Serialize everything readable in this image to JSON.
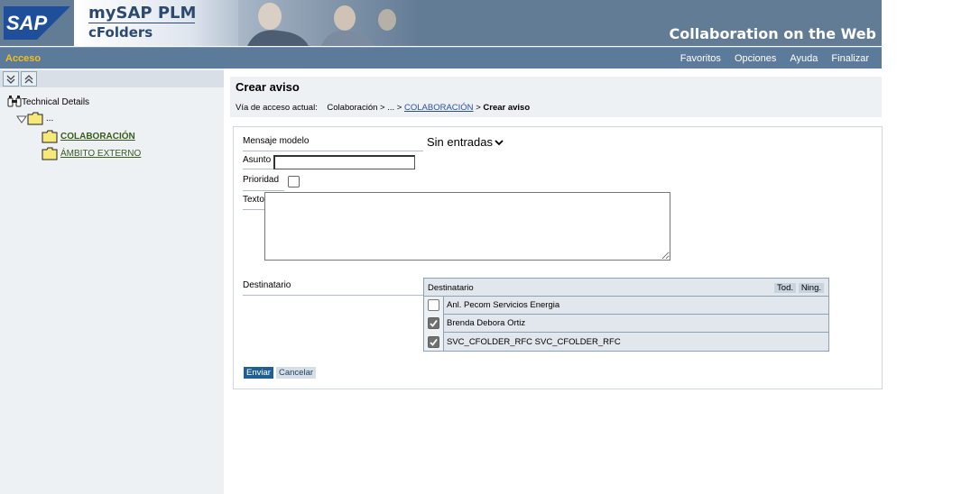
{
  "header": {
    "logo_text": "SAP",
    "brand_line1": "mySAP PLM",
    "brand_line2": "cFolders",
    "tagline": "Collaboration on the Web"
  },
  "navbar": {
    "section": "Acceso",
    "links": [
      "Favoritos",
      "Opciones",
      "Ayuda",
      "Finalizar"
    ]
  },
  "sidebar": {
    "tree": {
      "root_label": "Technical Details",
      "folder_label": "...",
      "children": [
        "COLABORACIÓN",
        "ÁMBITO EXTERNO"
      ]
    }
  },
  "main": {
    "title": "Crear aviso",
    "breadcrumb": {
      "prefix": "Vía de acceso actual:",
      "items": [
        "Colaboración",
        "...",
        "COLABORACIÓN",
        "Crear aviso"
      ],
      "separator": ">"
    }
  },
  "form": {
    "template_label": "Mensaje modelo",
    "template_value": "Sin entradas",
    "subject_label": "Asunto",
    "subject_value": "",
    "priority_label": "Prioridad",
    "priority_checked": false,
    "text_label": "Texto",
    "text_value": "",
    "recipient_label": "Destinatario",
    "recipients": {
      "header": "Destinatario",
      "select_all": "Tod.",
      "select_none": "Ning.",
      "rows": [
        {
          "name": "Anl. Pecom Servicios Energia",
          "checked": false
        },
        {
          "name": "Brenda Debora Ortiz",
          "checked": true
        },
        {
          "name": "SVC_CFOLDER_RFC SVC_CFOLDER_RFC",
          "checked": true
        }
      ]
    },
    "send_label": "Enviar",
    "cancel_label": "Cancelar"
  },
  "colors": {
    "header_bg": "#637c96",
    "navbar_bg": "#5c7a99",
    "accent_yellow": "#f0c020",
    "link_green": "#3a5a1e",
    "primary_button": "#1f5f91"
  }
}
